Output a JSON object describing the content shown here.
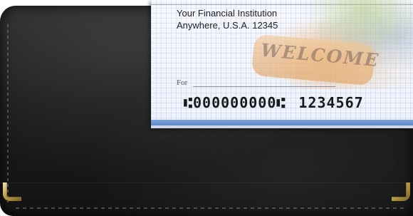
{
  "check": {
    "institution_name": "Your Financial Institution",
    "institution_address": "Anywhere, U.S.A.  12345",
    "for_label": "For",
    "watermark_text": "WELCOME",
    "micr_routing": "⑆000000000⑆",
    "micr_account": "1234567"
  },
  "colors": {
    "leather": "#1b1b1b",
    "brass": "#b89b45",
    "check_background": "#f1f4fc",
    "check_stripe": "#5c88cb"
  }
}
